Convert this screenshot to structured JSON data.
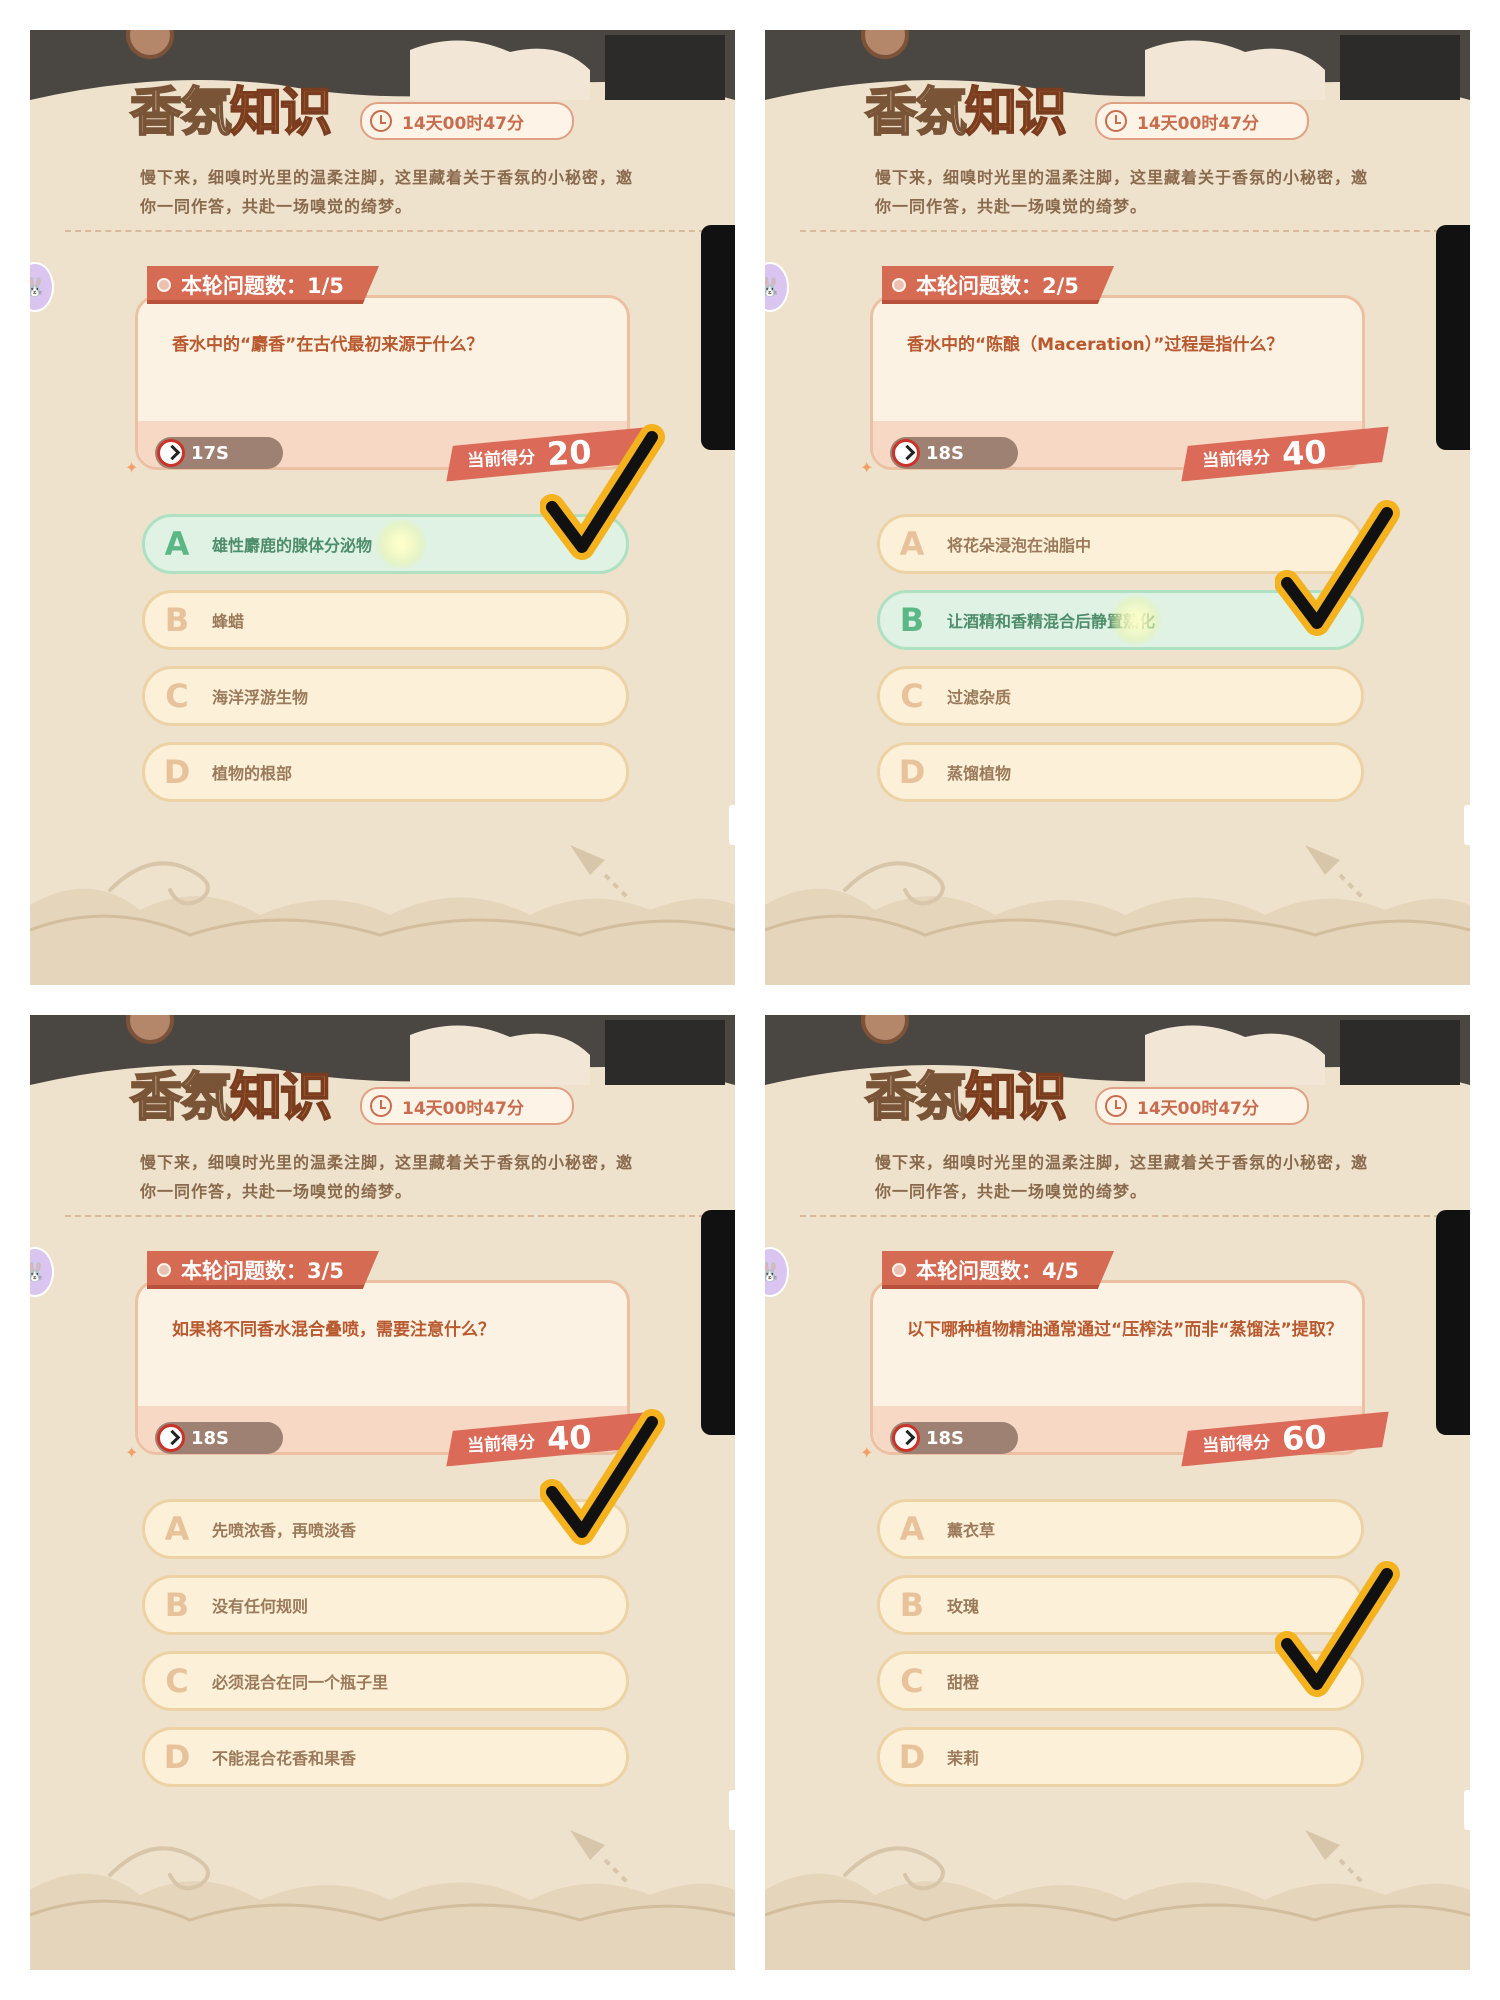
{
  "panels": [
    {
      "title_a": "香氛",
      "title_b": "知识",
      "timer": "14天00时47分",
      "intro": "慢下来，细嗅时光里的温柔注脚，这里藏着关于香氛的小秘密，邀你一同作答，共赴一场嗅觉的绮梦。",
      "round_label": "本轮问题数：1/5",
      "question": "香水中的“麝香”在古代最初来源于什么？",
      "countdown": "17S",
      "score_label": "当前得分",
      "score_value": "20",
      "options": [
        {
          "letter": "A",
          "text": "雄性麝鹿的腺体分泌物"
        },
        {
          "letter": "B",
          "text": "蜂蜡"
        },
        {
          "letter": "C",
          "text": "海洋浮游生物"
        },
        {
          "letter": "D",
          "text": "植物的根部"
        }
      ],
      "correct_option": "A",
      "checkmark_option": "A"
    },
    {
      "title_a": "香氛",
      "title_b": "知识",
      "timer": "14天00时47分",
      "intro": "慢下来，细嗅时光里的温柔注脚，这里藏着关于香氛的小秘密，邀你一同作答，共赴一场嗅觉的绮梦。",
      "round_label": "本轮问题数：2/5",
      "question": "香水中的“陈酿（Maceration）”过程是指什么？",
      "countdown": "18S",
      "score_label": "当前得分",
      "score_value": "40",
      "options": [
        {
          "letter": "A",
          "text": "将花朵浸泡在油脂中"
        },
        {
          "letter": "B",
          "text": "让酒精和香精混合后静置熟化"
        },
        {
          "letter": "C",
          "text": "过滤杂质"
        },
        {
          "letter": "D",
          "text": "蒸馏植物"
        }
      ],
      "correct_option": "B",
      "checkmark_option": "B"
    },
    {
      "title_a": "香氛",
      "title_b": "知识",
      "timer": "14天00时47分",
      "intro": "慢下来，细嗅时光里的温柔注脚，这里藏着关于香氛的小秘密，邀你一同作答，共赴一场嗅觉的绮梦。",
      "round_label": "本轮问题数：3/5",
      "question": "如果将不同香水混合叠喷，需要注意什么？",
      "countdown": "18S",
      "score_label": "当前得分",
      "score_value": "40",
      "options": [
        {
          "letter": "A",
          "text": "先喷浓香，再喷淡香"
        },
        {
          "letter": "B",
          "text": "没有任何规则"
        },
        {
          "letter": "C",
          "text": "必须混合在同一个瓶子里"
        },
        {
          "letter": "D",
          "text": "不能混合花香和果香"
        }
      ],
      "correct_option": "",
      "checkmark_option": "A"
    },
    {
      "title_a": "香氛",
      "title_b": "知识",
      "timer": "14天00时47分",
      "intro": "慢下来，细嗅时光里的温柔注脚，这里藏着关于香氛的小秘密，邀你一同作答，共赴一场嗅觉的绮梦。",
      "round_label": "本轮问题数：4/5",
      "question": "以下哪种植物精油通常通过“压榨法”而非“蒸馏法”提取？",
      "countdown": "18S",
      "score_label": "当前得分",
      "score_value": "60",
      "options": [
        {
          "letter": "A",
          "text": "薰衣草"
        },
        {
          "letter": "B",
          "text": "玫瑰"
        },
        {
          "letter": "C",
          "text": "甜橙"
        },
        {
          "letter": "D",
          "text": "茉莉"
        }
      ],
      "correct_option": "",
      "checkmark_option": "C"
    }
  ],
  "colors": {
    "background": "#eee2cd",
    "accent_red": "#d56b52",
    "correct_green": "#dff2e4",
    "checkmark": "#f4b21e"
  },
  "icons": [
    "clock-icon",
    "bunny-icon",
    "countdown-icon",
    "checkmark-icon"
  ]
}
